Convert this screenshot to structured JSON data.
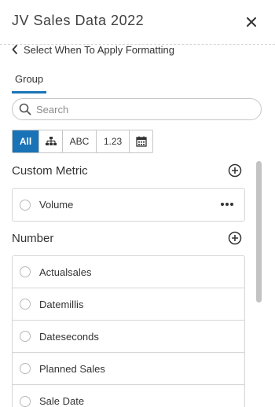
{
  "header": {
    "title": "JV Sales Data 2022",
    "close_icon": "close-icon"
  },
  "back": {
    "label": "Select When To Apply Formatting",
    "icon": "chevron-left-icon"
  },
  "tabs": [
    {
      "label": "Group",
      "active": true
    }
  ],
  "search": {
    "placeholder": "Search",
    "value": "",
    "icon": "search-icon"
  },
  "filters": [
    {
      "label": "All",
      "active": true
    },
    {
      "label": "",
      "icon": "hierarchy-icon"
    },
    {
      "label": "ABC"
    },
    {
      "label": "1.23"
    },
    {
      "label": "",
      "icon": "calendar-icon"
    }
  ],
  "sections": [
    {
      "title": "Custom Metric",
      "items": [
        {
          "label": "Volume",
          "has_menu": true
        }
      ]
    },
    {
      "title": "Number",
      "items": [
        {
          "label": "Actualsales"
        },
        {
          "label": "Datemillis"
        },
        {
          "label": "Dateseconds"
        },
        {
          "label": "Planned Sales"
        },
        {
          "label": "Sale Date"
        }
      ]
    }
  ],
  "colors": {
    "accent": "#1a73b7",
    "border": "#d6d6d6",
    "text": "#333333"
  }
}
